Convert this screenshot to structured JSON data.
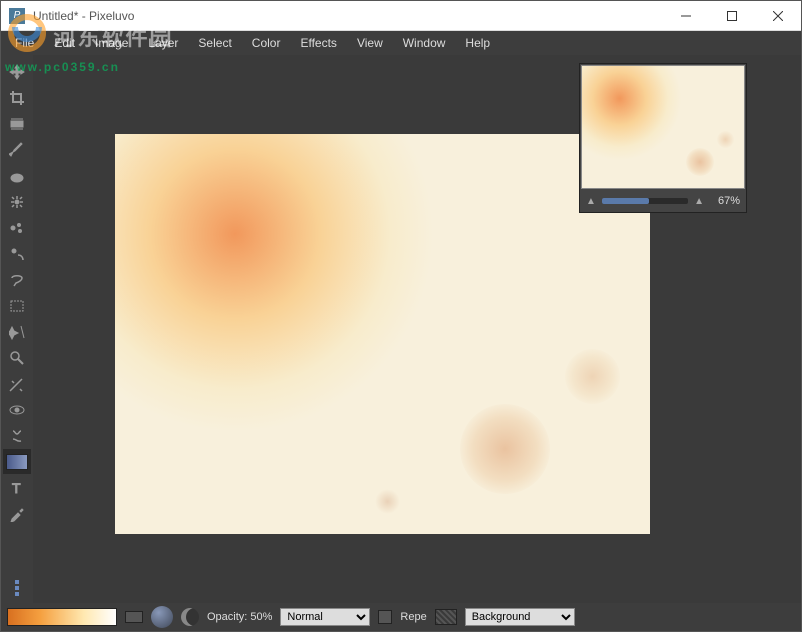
{
  "window": {
    "title": "Untitled* - Pixeluvo",
    "app_initial": "P"
  },
  "menu": {
    "file": "File",
    "edit": "Edit",
    "image": "Image",
    "layer": "Layer",
    "select": "Select",
    "color": "Color",
    "effects": "Effects",
    "view": "View",
    "window": "Window",
    "help": "Help"
  },
  "watermark": {
    "text": "河东软件园",
    "url": "www.pc0359.cn"
  },
  "navigator": {
    "zoom": "67%"
  },
  "options": {
    "opacity_label": "Opacity: 50%",
    "blend_mode": "Normal",
    "repeat_label": "Repe",
    "target": "Background"
  },
  "tools": {
    "move": "move",
    "crop": "crop",
    "transform": "transform",
    "brush": "brush",
    "smudge": "smudge",
    "clone": "clone",
    "heal": "heal",
    "dodge": "dodge",
    "lasso": "lasso",
    "marquee": "marquee",
    "wand": "wand",
    "zoom": "zoom",
    "effect": "effect",
    "redeye": "redeye",
    "liquify": "liquify",
    "gradient": "gradient",
    "text": "text",
    "picker": "picker"
  }
}
